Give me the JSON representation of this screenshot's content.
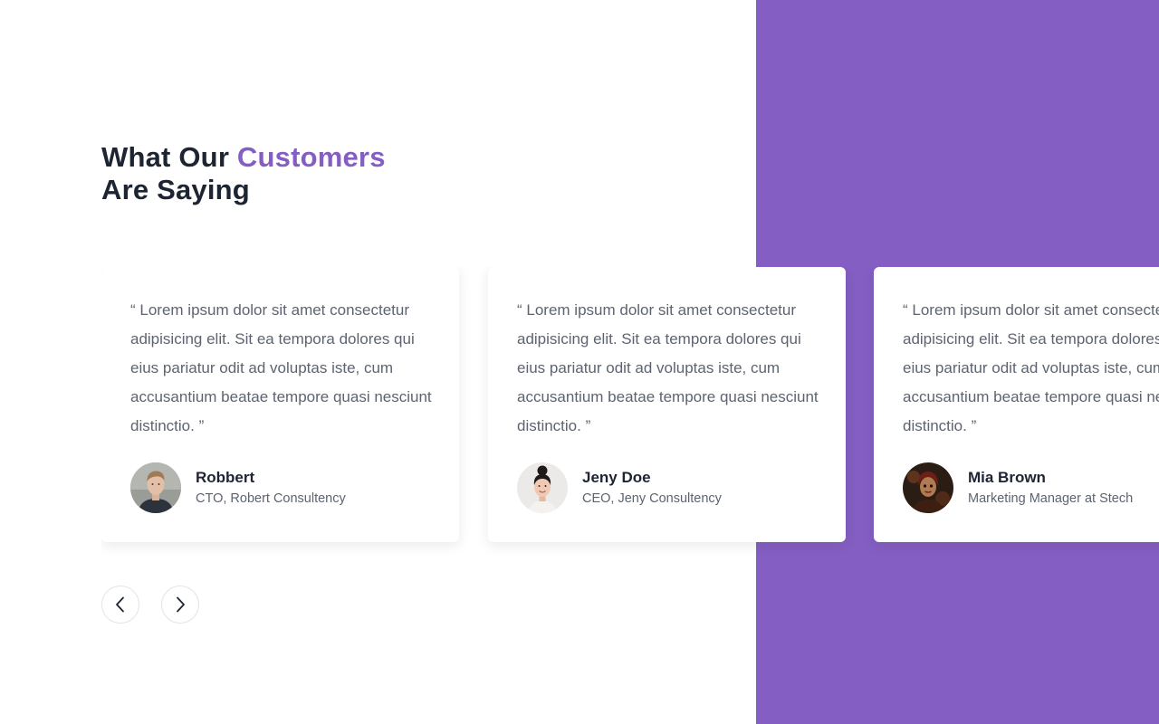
{
  "section": {
    "title_prefix": "What Our ",
    "title_accent": "Customers",
    "title_suffix": "Are Saying",
    "accent_color": "#845ec2",
    "panel_color": "#845ec2"
  },
  "testimonials": [
    {
      "quote": "“ Lorem ipsum dolor sit amet consectetur adipisicing elit. Sit ea tempora dolores qui eius pariatur odit ad voluptas iste, cum accusantium beatae tempore quasi nesciunt distinctio. ”",
      "name": "Robbert",
      "role": "CTO, Robert Consultency",
      "avatar": "avatar-man-icon"
    },
    {
      "quote": "“ Lorem ipsum dolor sit amet consectetur adipisicing elit. Sit ea tempora dolores qui eius pariatur odit ad voluptas iste, cum accusantium beatae tempore quasi nesciunt distinctio. ”",
      "name": "Jeny Doe",
      "role": "CEO, Jeny Consultency",
      "avatar": "avatar-woman-icon"
    },
    {
      "quote": "“ Lorem ipsum dolor sit amet consectetur adipisicing elit. Sit ea tempora dolores qui eius pariatur odit ad voluptas iste, cum accusantium beatae tempore quasi nesciunt distinctio. ”",
      "name": "Mia Brown",
      "role": "Marketing Manager at Stech",
      "avatar": "avatar-costume-icon"
    }
  ],
  "controls": {
    "prev_icon": "chevron-left-icon",
    "next_icon": "chevron-right-icon"
  }
}
